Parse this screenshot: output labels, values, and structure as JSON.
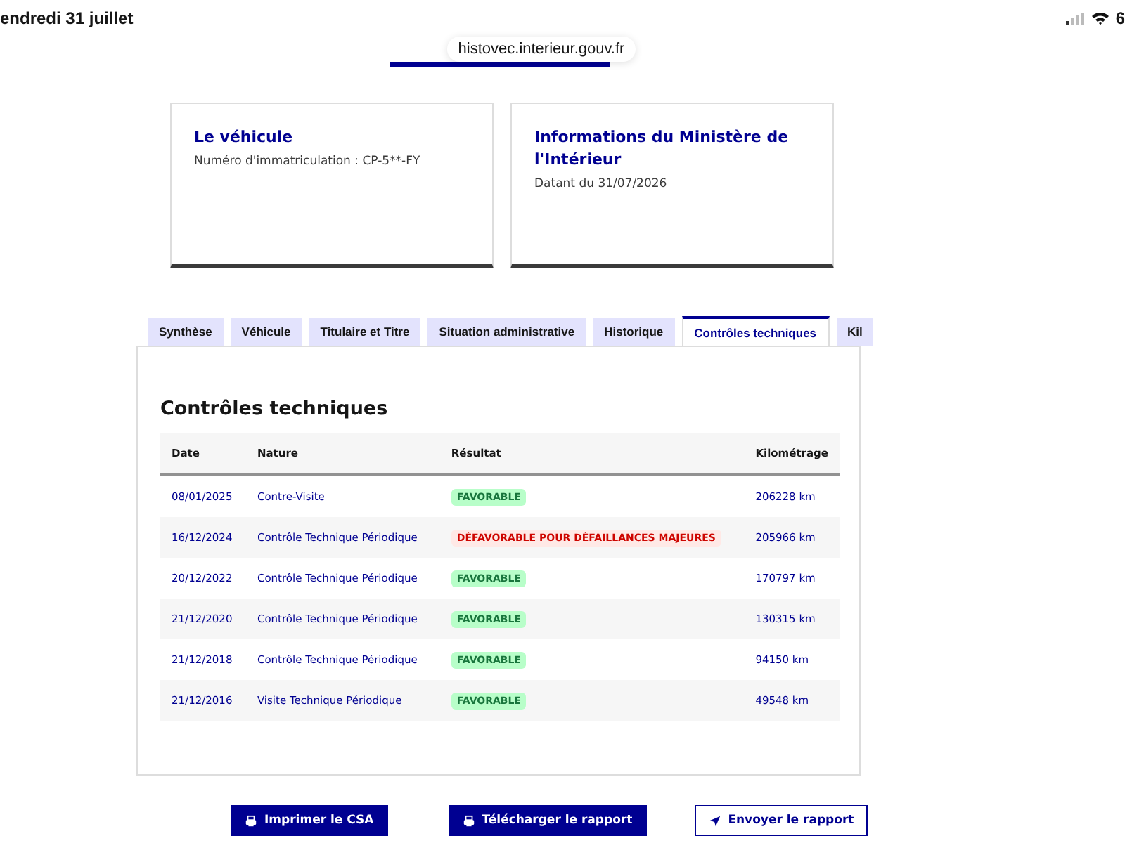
{
  "status_bar": {
    "date": "endredi 31 juillet",
    "battery": "6"
  },
  "url": "histovec.interieur.gouv.fr",
  "cards": [
    {
      "title": "Le véhicule",
      "text": "Numéro d'immatriculation : CP-5**-FY"
    },
    {
      "title": "Informations du Ministère de l'Intérieur",
      "text": "Datant du 31/07/2026"
    }
  ],
  "tabs": [
    {
      "label": "Synthèse",
      "selected": false
    },
    {
      "label": "Véhicule",
      "selected": false
    },
    {
      "label": "Titulaire et Titre",
      "selected": false
    },
    {
      "label": "Situation administrative",
      "selected": false
    },
    {
      "label": "Historique",
      "selected": false
    },
    {
      "label": "Contrôles techniques",
      "selected": true
    },
    {
      "label": "Kil",
      "selected": false
    }
  ],
  "section_title": "Contrôles techniques",
  "table": {
    "columns": [
      "Date",
      "Nature",
      "Résultat",
      "Kilométrage"
    ],
    "rows": [
      {
        "date": "08/01/2025",
        "nature": "Contre-Visite",
        "result": {
          "label": "FAVORABLE",
          "kind": "favorable"
        },
        "km": "206228 km"
      },
      {
        "date": "16/12/2024",
        "nature": "Contrôle Technique Périodique",
        "result": {
          "label": "DÉFAVORABLE POUR DÉFAILLANCES MAJEURES",
          "kind": "defavorable"
        },
        "km": "205966 km"
      },
      {
        "date": "20/12/2022",
        "nature": "Contrôle Technique Périodique",
        "result": {
          "label": "FAVORABLE",
          "kind": "favorable"
        },
        "km": "170797 km"
      },
      {
        "date": "21/12/2020",
        "nature": "Contrôle Technique Périodique",
        "result": {
          "label": "FAVORABLE",
          "kind": "favorable"
        },
        "km": "130315 km"
      },
      {
        "date": "21/12/2018",
        "nature": "Contrôle Technique Périodique",
        "result": {
          "label": "FAVORABLE",
          "kind": "favorable"
        },
        "km": "94150 km"
      },
      {
        "date": "21/12/2016",
        "nature": "Visite Technique Périodique",
        "result": {
          "label": "FAVORABLE",
          "kind": "favorable"
        },
        "km": "49548 km"
      }
    ]
  },
  "buttons": [
    {
      "label": "Imprimer le CSA",
      "kind": "print"
    },
    {
      "label": "Télécharger le rapport",
      "kind": "print"
    },
    {
      "label": "Envoyer le rapport",
      "kind": "send"
    }
  ]
}
